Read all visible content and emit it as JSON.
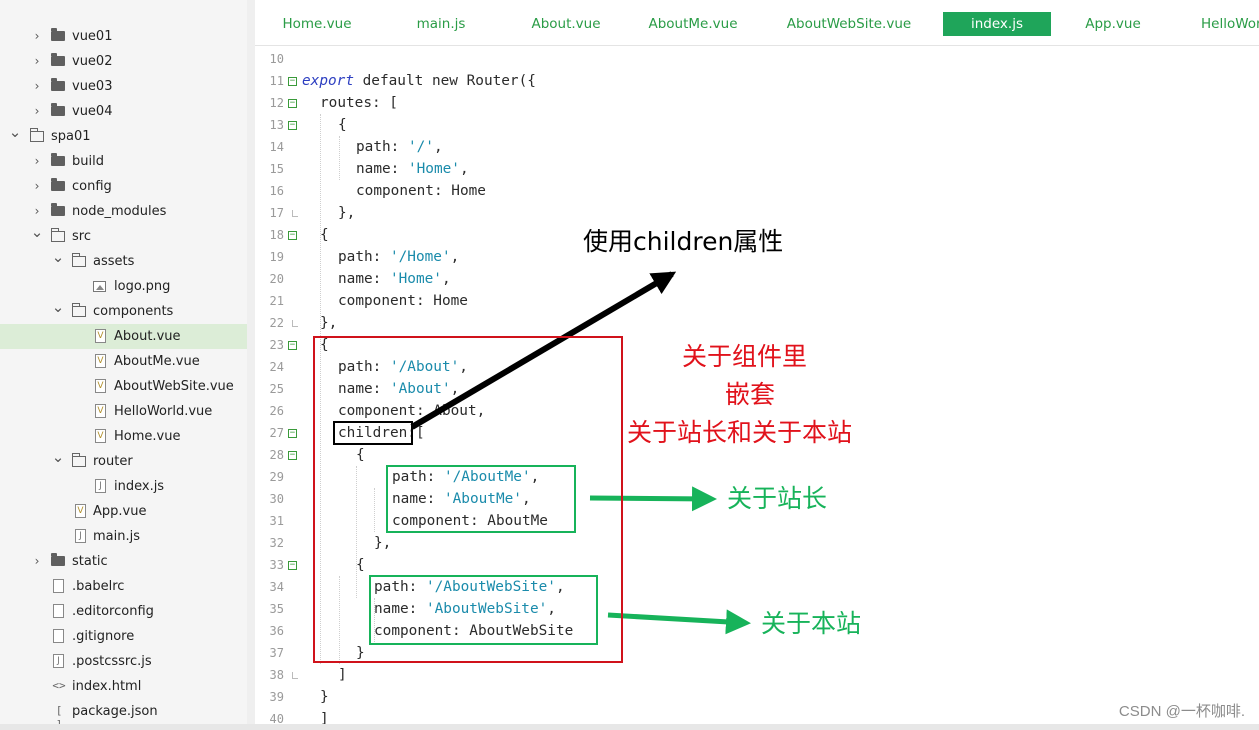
{
  "sidebar": {
    "items": [
      {
        "label": "vue01",
        "type": "folder",
        "chevron": "right"
      },
      {
        "label": "vue02",
        "type": "folder",
        "chevron": "right"
      },
      {
        "label": "vue03",
        "type": "folder",
        "chevron": "right"
      },
      {
        "label": "vue04",
        "type": "folder",
        "chevron": "right"
      },
      {
        "label": "spa01",
        "type": "project",
        "chevron": "down"
      },
      {
        "label": "build",
        "type": "folder",
        "chevron": "right"
      },
      {
        "label": "config",
        "type": "folder",
        "chevron": "right"
      },
      {
        "label": "node_modules",
        "type": "folder",
        "chevron": "right"
      },
      {
        "label": "src",
        "type": "folder-open",
        "chevron": "down"
      },
      {
        "label": "assets",
        "type": "folder-open",
        "chevron": "down"
      },
      {
        "label": "logo.png",
        "type": "image"
      },
      {
        "label": "components",
        "type": "folder-open",
        "chevron": "down"
      },
      {
        "label": "About.vue",
        "type": "vue",
        "selected": true
      },
      {
        "label": "AboutMe.vue",
        "type": "vue"
      },
      {
        "label": "AboutWebSite.vue",
        "type": "vue"
      },
      {
        "label": "HelloWorld.vue",
        "type": "vue"
      },
      {
        "label": "Home.vue",
        "type": "vue"
      },
      {
        "label": "router",
        "type": "folder-open",
        "chevron": "down"
      },
      {
        "label": "index.js",
        "type": "js"
      },
      {
        "label": "App.vue",
        "type": "vue"
      },
      {
        "label": "main.js",
        "type": "js"
      },
      {
        "label": "static",
        "type": "folder",
        "chevron": "right"
      },
      {
        "label": ".babelrc",
        "type": "plain"
      },
      {
        "label": ".editorconfig",
        "type": "plain"
      },
      {
        "label": ".gitignore",
        "type": "plain"
      },
      {
        "label": ".postcssrc.js",
        "type": "js"
      },
      {
        "label": "index.html",
        "type": "html",
        "glyph": "<>"
      },
      {
        "label": "package.json",
        "type": "json",
        "glyph": "[ ]"
      }
    ]
  },
  "tabs": [
    {
      "label": "Home.vue"
    },
    {
      "label": "main.js"
    },
    {
      "label": "About.vue"
    },
    {
      "label": "AboutMe.vue"
    },
    {
      "label": "AboutWebSite.vue"
    },
    {
      "label": "index.js",
      "active": true
    },
    {
      "label": "App.vue"
    },
    {
      "label": "HelloWor"
    }
  ],
  "editor": {
    "line_numbers": [
      "10",
      "11",
      "12",
      "13",
      "14",
      "15",
      "16",
      "17",
      "18",
      "19",
      "20",
      "21",
      "22",
      "23",
      "24",
      "25",
      "26",
      "27",
      "28",
      "29",
      "30",
      "31",
      "32",
      "33",
      "34",
      "35",
      "36",
      "37",
      "38",
      "39",
      "40"
    ],
    "code": [
      "export default new Router({",
      "routes: [",
      "{",
      "path: '/',",
      "name: 'Home',",
      "component: Home",
      "},",
      "{",
      "path: '/Home',",
      "name: 'Home',",
      "component: Home",
      "},",
      "{",
      "path: '/About',",
      "name: 'About',",
      "component: About,",
      "children:[",
      "{",
      "path: '/AboutMe',",
      "name: 'AboutMe',",
      "component: AboutMe",
      "},",
      "{",
      "path: '/AboutWebSite',",
      "name: 'AboutWebSite',",
      "component: AboutWebSite",
      "}",
      "]",
      "}",
      "]"
    ]
  },
  "annotations": {
    "children_label": "使用children属性",
    "nested_title": [
      "关于组件里",
      "嵌套",
      "关于站长和关于本站"
    ],
    "about_me": "关于站长",
    "about_site": "关于本站",
    "colors": {
      "red": "#e1121b",
      "green": "#17b35a",
      "black": "#000000"
    }
  },
  "watermark": "CSDN @一杯咖啡."
}
